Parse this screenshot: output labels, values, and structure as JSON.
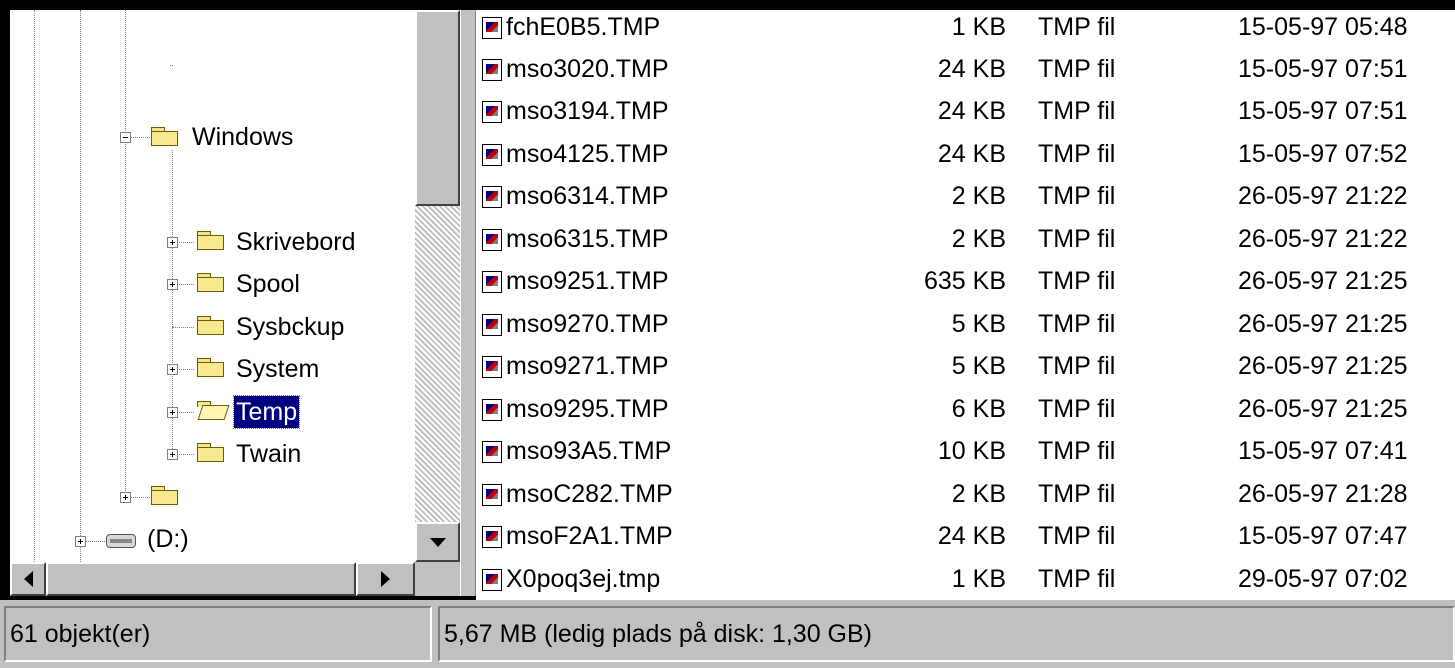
{
  "tree": {
    "items": [
      {
        "label": "Windows",
        "expander": "minus"
      },
      {
        "label": "Skrivebord",
        "expander": "plus"
      },
      {
        "label": "Spool",
        "expander": "plus"
      },
      {
        "label": "Sysbckup",
        "expander": "none"
      },
      {
        "label": "System",
        "expander": "plus"
      },
      {
        "label": "Temp",
        "expander": "plus",
        "selected": true
      },
      {
        "label": "Twain",
        "expander": "plus"
      },
      {
        "label": "",
        "expander": "plus"
      },
      {
        "label": "(D:)",
        "expander": "plus"
      }
    ]
  },
  "files": [
    {
      "name": "fchE0B5.TMP",
      "size": "1 KB",
      "type": "TMP fil",
      "modified": "15-05-97 05:48"
    },
    {
      "name": "mso3020.TMP",
      "size": "24 KB",
      "type": "TMP fil",
      "modified": "15-05-97 07:51"
    },
    {
      "name": "mso3194.TMP",
      "size": "24 KB",
      "type": "TMP fil",
      "modified": "15-05-97 07:51"
    },
    {
      "name": "mso4125.TMP",
      "size": "24 KB",
      "type": "TMP fil",
      "modified": "15-05-97 07:52"
    },
    {
      "name": "mso6314.TMP",
      "size": "2 KB",
      "type": "TMP fil",
      "modified": "26-05-97 21:22"
    },
    {
      "name": "mso6315.TMP",
      "size": "2 KB",
      "type": "TMP fil",
      "modified": "26-05-97 21:22"
    },
    {
      "name": "mso9251.TMP",
      "size": "635 KB",
      "type": "TMP fil",
      "modified": "26-05-97 21:25"
    },
    {
      "name": "mso9270.TMP",
      "size": "5 KB",
      "type": "TMP fil",
      "modified": "26-05-97 21:25"
    },
    {
      "name": "mso9271.TMP",
      "size": "5 KB",
      "type": "TMP fil",
      "modified": "26-05-97 21:25"
    },
    {
      "name": "mso9295.TMP",
      "size": "6 KB",
      "type": "TMP fil",
      "modified": "26-05-97 21:25"
    },
    {
      "name": "mso93A5.TMP",
      "size": "10 KB",
      "type": "TMP fil",
      "modified": "15-05-97 07:41"
    },
    {
      "name": "msoC282.TMP",
      "size": "2 KB",
      "type": "TMP fil",
      "modified": "26-05-97 21:28"
    },
    {
      "name": "msoF2A1.TMP",
      "size": "24 KB",
      "type": "TMP fil",
      "modified": "15-05-97 07:47"
    },
    {
      "name": "X0poq3ej.tmp",
      "size": "1 KB",
      "type": "TMP fil",
      "modified": "29-05-97 07:02"
    }
  ],
  "status": {
    "object_count": "61 objekt(er)",
    "disk_info": "5,67 MB (ledig plads på disk: 1,30 GB)"
  },
  "colors": {
    "selection": "#000080",
    "face": "#c0c0c0",
    "window": "#ffffff"
  }
}
